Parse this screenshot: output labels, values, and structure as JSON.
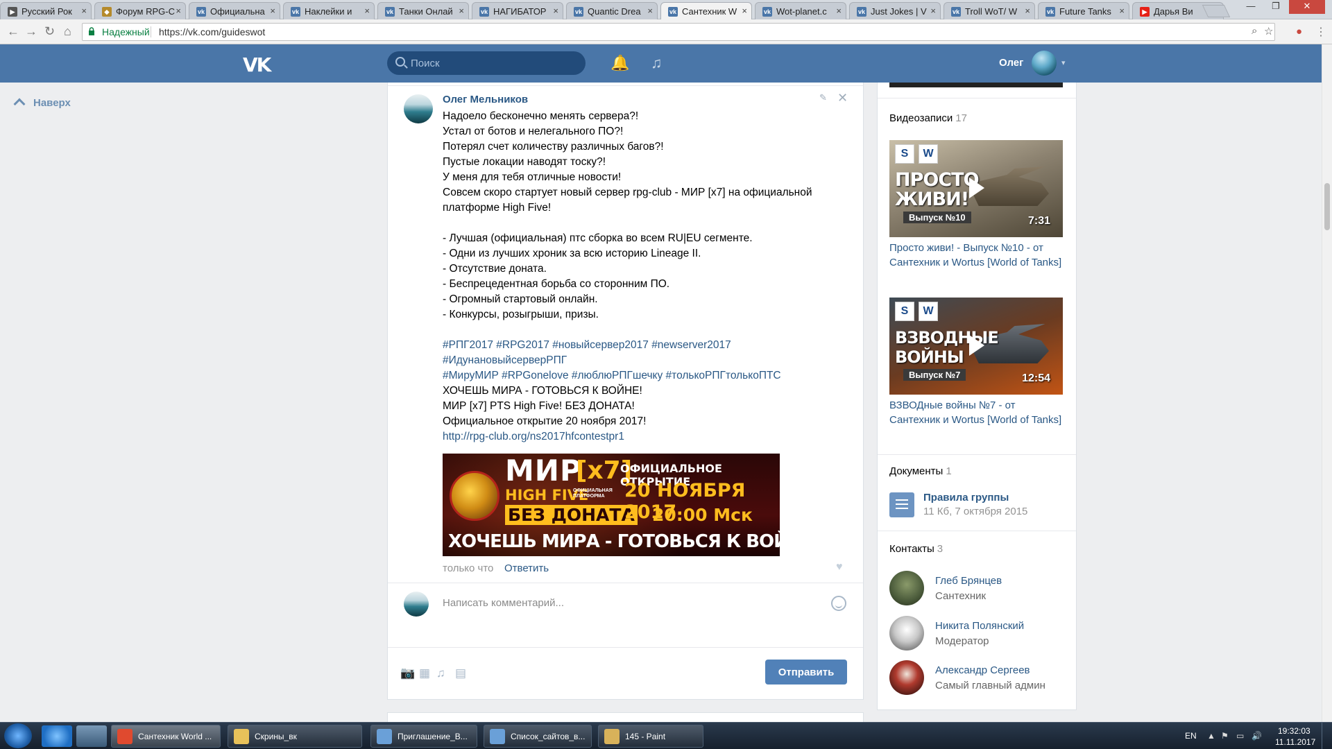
{
  "browser": {
    "tabs": [
      {
        "title": "Русский Рок",
        "favicon_color": "#555555",
        "fav_glyph": "▶"
      },
      {
        "title": "Форум RPG-C",
        "favicon_color": "#b58a2b",
        "fav_glyph": "◆"
      },
      {
        "title": "Официальна",
        "favicon_color": "#4a76a8",
        "fav_glyph": "vk"
      },
      {
        "title": "Наклейки и",
        "favicon_color": "#4a76a8",
        "fav_glyph": "vk"
      },
      {
        "title": "Танки Онлай",
        "favicon_color": "#4a76a8",
        "fav_glyph": "vk"
      },
      {
        "title": "НАГИБАТОР",
        "favicon_color": "#4a76a8",
        "fav_glyph": "vk"
      },
      {
        "title": "Quantic Drea",
        "favicon_color": "#4a76a8",
        "fav_glyph": "vk"
      },
      {
        "title": "Сантехник W",
        "favicon_color": "#4a76a8",
        "fav_glyph": "vk"
      },
      {
        "title": "Wot-planet.c",
        "favicon_color": "#4a76a8",
        "fav_glyph": "vk"
      },
      {
        "title": "Just Jokes | V",
        "favicon_color": "#4a76a8",
        "fav_glyph": "vk"
      },
      {
        "title": "Troll WoT/ W",
        "favicon_color": "#4a76a8",
        "fav_glyph": "vk"
      },
      {
        "title": "Future Tanks",
        "favicon_color": "#4a76a8",
        "fav_glyph": "vk"
      },
      {
        "title": "Дарья Ви",
        "favicon_color": "#e62117",
        "fav_glyph": "▶"
      }
    ],
    "close_glyph": "×",
    "win_minimize": "—",
    "win_restore": "❐",
    "win_close": "✕",
    "nav_back": "←",
    "nav_forward": "→",
    "nav_reload": "↻",
    "nav_home": "⌂",
    "secure_label": "Надежный",
    "url": "https://vk.com/guideswot",
    "zoom_glyph": "⌕",
    "star_glyph": "☆",
    "menu_glyph": "⋮"
  },
  "vk": {
    "logo": "VK",
    "search_placeholder": "Поиск",
    "bell_glyph": "🔔",
    "music_glyph": "♫",
    "user_name": "Олег",
    "caret": "▾"
  },
  "sidebar": {
    "up_label": "Наверх"
  },
  "post": {
    "author": "Олег Мельников",
    "edit_glyph": "✎",
    "close_glyph": "✕",
    "lines": [
      {
        "text": "Надоело бесконечно менять сервера?!",
        "kind": "text"
      },
      {
        "text": "Устал от ботов и нелегального ПО?!",
        "kind": "text"
      },
      {
        "text": "Потерял счет количеству различных багов?!",
        "kind": "text"
      },
      {
        "text": "Пустые локации наводят тоску?!",
        "kind": "text"
      },
      {
        "text": "У меня для тебя отличные новости!",
        "kind": "text"
      },
      {
        "text": "Совсем скоро стартует новый сервер rpg-club - МИР [x7] на официальной",
        "kind": "text"
      },
      {
        "text": "платформе High Five!",
        "kind": "text"
      },
      {
        "text": "",
        "kind": "gap"
      },
      {
        "text": "- Лучшая (официальная) птс сборка во всем RU|EU сегменте.",
        "kind": "text"
      },
      {
        "text": "- Одни из лучших хроник за всю историю Lineage II.",
        "kind": "text"
      },
      {
        "text": "- Отсутствие доната.",
        "kind": "text"
      },
      {
        "text": "- Беспрецедентная борьба со сторонним ПО.",
        "kind": "text"
      },
      {
        "text": "- Огромный стартовый онлайн.",
        "kind": "text"
      },
      {
        "text": "- Конкурсы, розыгрыши, призы.",
        "kind": "text"
      },
      {
        "text": "",
        "kind": "gap"
      },
      {
        "text": "#РПГ2017 #RPG2017 #новыйсервер2017 #newserver2017",
        "kind": "tag"
      },
      {
        "text": "#ИдунановыйсерверРПГ",
        "kind": "tag"
      },
      {
        "text": "#МируМИР #RPGonelove #люблюРПГшечку #толькоРПГтолькоПТС",
        "kind": "tag"
      },
      {
        "text": "ХОЧЕШЬ МИРА - ГОТОВЬСЯ К ВОЙНЕ!",
        "kind": "text"
      },
      {
        "text": "МИР [x7] PTS High Five! БЕЗ ДОНАТА!",
        "kind": "text"
      },
      {
        "text": "Официальное открытие 20 ноября 2017!",
        "kind": "text"
      },
      {
        "text": "http://rpg-club.org/ns2017hfcontestpr1",
        "kind": "link"
      }
    ],
    "banner": {
      "mir": "МИР",
      "x7": "[x7]",
      "high_five": "HIGH FIVE",
      "platform": "ОФИЦИАЛЬНАЯ ПЛАТФОРМА",
      "no_donate": "БЕЗ ДОНАТА",
      "opening": "ОФИЦИАЛЬНОЕ ОТКРЫТИЕ",
      "date": "20 НОЯБРЯ 2017",
      "time": "20:00 Мск",
      "slogan": "ХОЧЕШЬ МИРА - ГОТОВЬСЯ К ВОЙНЕ"
    },
    "time": "только что",
    "reply_label": "Ответить",
    "like_glyph": "♥",
    "comment_placeholder": "Написать комментарий...",
    "attach_photo_glyph": "📷",
    "attach_video_glyph": "▦",
    "attach_audio_glyph": "♫",
    "attach_doc_glyph": "▤",
    "send_label": "Отправить"
  },
  "right": {
    "videos_title": "Видеозаписи",
    "videos_count": "17",
    "videos": [
      {
        "big_line1": "ПРОСТО",
        "big_line2": "ЖИВИ!",
        "episode": "Выпуск №10",
        "duration": "7:31",
        "title": "Просто живи! - Выпуск №10 - от Сантехник и Wortus [World of Tanks]"
      },
      {
        "big_line1": "ВЗВОДНЫЕ",
        "big_line2": "ВОЙНЫ",
        "episode": "Выпуск №7",
        "duration": "12:54",
        "title": "ВЗВОДные войны №7 - от Сантехник и Wortus [World of Tanks]"
      }
    ],
    "docs_title": "Документы",
    "docs_count": "1",
    "doc": {
      "name": "Правила группы",
      "meta": "11 Кб, 7 октября 2015"
    },
    "contacts_title": "Контакты",
    "contacts_count": "3",
    "contacts": [
      {
        "name": "Глеб Брянцев",
        "role": "Сантехник"
      },
      {
        "name": "Никита Полянский",
        "role": "Модератор"
      },
      {
        "name": "Александр Сергеев",
        "role": "Самый главный админ"
      }
    ]
  },
  "taskbar": {
    "items": [
      {
        "label": "Сантехник World ...",
        "color": "#e04a2f"
      },
      {
        "label": "Скрины_вк",
        "color": "#e8c25a"
      },
      {
        "label": "Приглашение_В...",
        "color": "#6aa0d8"
      },
      {
        "label": "Список_сайтов_в...",
        "color": "#6aa0d8"
      },
      {
        "label": "145 - Paint",
        "color": "#d8b25a"
      }
    ],
    "lang": "EN",
    "tray_up": "▲",
    "tray_flag": "⚑",
    "tray_net": "▭",
    "tray_vol": "🔊",
    "time": "19:32:03",
    "date": "11.11.2017"
  }
}
